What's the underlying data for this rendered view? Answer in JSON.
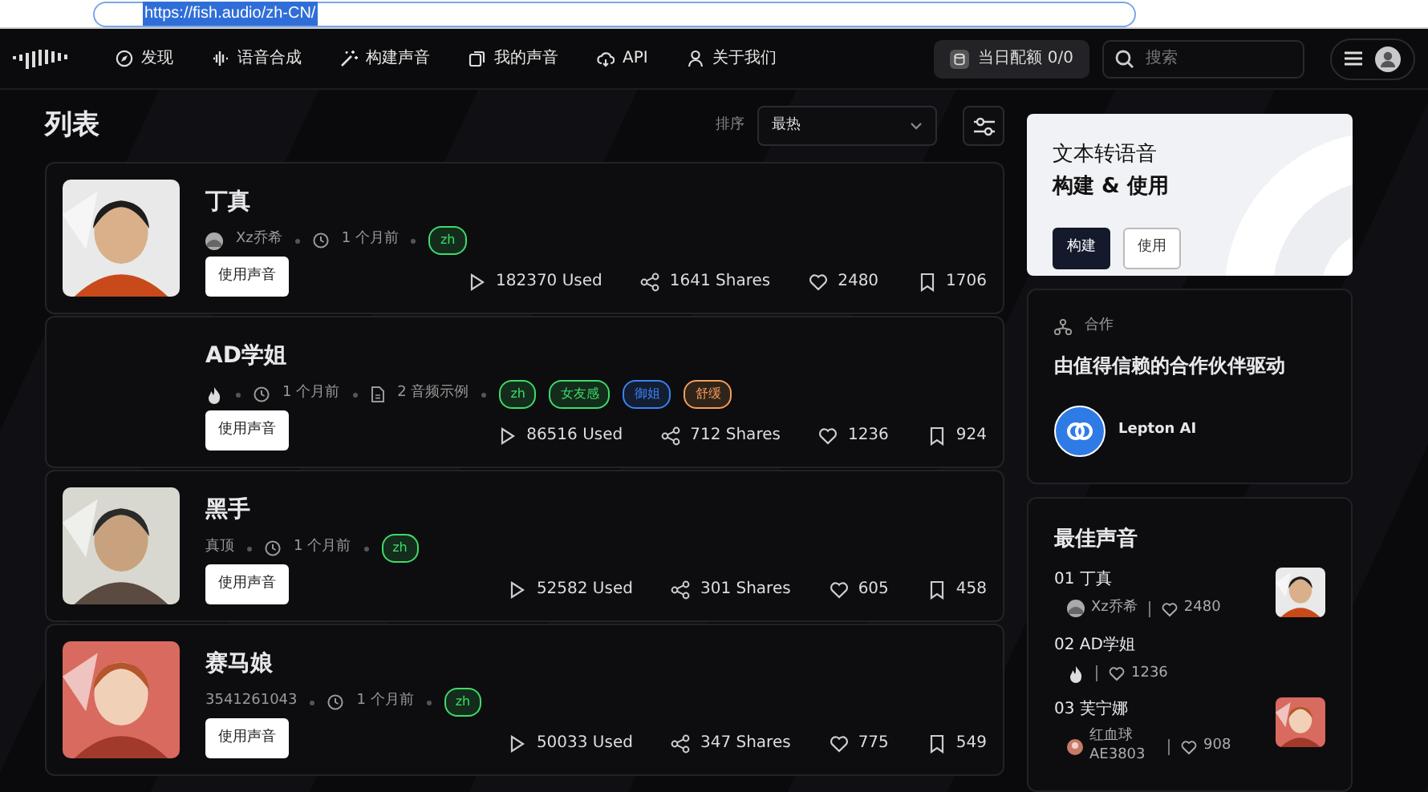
{
  "browser": {
    "url": "https://fish.audio/zh-CN/"
  },
  "nav": {
    "items": [
      {
        "label": "发现"
      },
      {
        "label": "语音合成"
      },
      {
        "label": "构建声音"
      },
      {
        "label": "我的声音"
      },
      {
        "label": "API"
      },
      {
        "label": "关于我们"
      }
    ],
    "quota_label": "当日配额",
    "quota": "0/0",
    "search_placeholder": "搜索"
  },
  "list": {
    "title": "列表",
    "sort_label": "排序",
    "sort_value": "最热",
    "voices": [
      {
        "title": "丁真",
        "image": {
          "kind": "picture"
        },
        "author": "Xz乔希",
        "author_avatar": true,
        "time": "1 个月前",
        "tags": [
          {
            "label": "zh",
            "color": "#3ddc6a"
          }
        ],
        "button": "使用声音",
        "used": "182370 Used",
        "shares": "1641 Shares",
        "likes": "2480",
        "bookmarks": "1706"
      },
      {
        "title": "AD学姐",
        "author_avatar": true,
        "time": "1 个月前",
        "samples": "2 音频示例",
        "tags": [
          {
            "label": "zh",
            "color": "#3ddc6a"
          },
          {
            "label": "女友感",
            "color": "#3ddc6a"
          },
          {
            "label": "御姐",
            "color": "#3b82f6"
          },
          {
            "label": "舒缓",
            "color": "#f59e5b"
          }
        ],
        "button": "使用声音",
        "used": "86516 Used",
        "shares": "712 Shares",
        "likes": "1236",
        "bookmarks": "924"
      },
      {
        "title": "黑手",
        "image": {
          "kind": "picture"
        },
        "author": "真顶",
        "author_avatar": false,
        "time": "1 个月前",
        "tags": [
          {
            "label": "zh",
            "color": "#3ddc6a"
          }
        ],
        "button": "使用声音",
        "used": "52582 Used",
        "shares": "301 Shares",
        "likes": "605",
        "bookmarks": "458"
      },
      {
        "title": "赛马娘",
        "image": {
          "kind": "picture"
        },
        "author": "3541261043",
        "author_avatar": false,
        "time": "1 个月前",
        "tags": [
          {
            "label": "zh",
            "color": "#3ddc6a"
          }
        ],
        "button": "使用声音",
        "used": "50033 Used",
        "shares": "347 Shares",
        "likes": "775",
        "bookmarks": "549"
      }
    ]
  },
  "promo": {
    "title": "文本转语音",
    "subtitle": "构建 & 使用",
    "buttons": [
      {
        "label": "构建",
        "kind": "primary"
      },
      {
        "label": "使用",
        "kind": "outline"
      }
    ]
  },
  "partners": {
    "label": "合作",
    "heading": "由值得信赖的合作伙伴驱动",
    "items": [
      {
        "name": "Lepton AI"
      }
    ]
  },
  "top_voices": {
    "title": "最佳声音",
    "items": [
      {
        "rank": "01",
        "name": "丁真",
        "author": "Xz乔希",
        "likes": "2480",
        "image": {
          "kind": "picture"
        }
      },
      {
        "rank": "02",
        "name": "AD学姐",
        "likes": "1236"
      },
      {
        "rank": "03",
        "name": "芙宁娜",
        "author": "红血球AE3803",
        "likes": "908",
        "image": {
          "kind": "picture"
        }
      }
    ]
  }
}
